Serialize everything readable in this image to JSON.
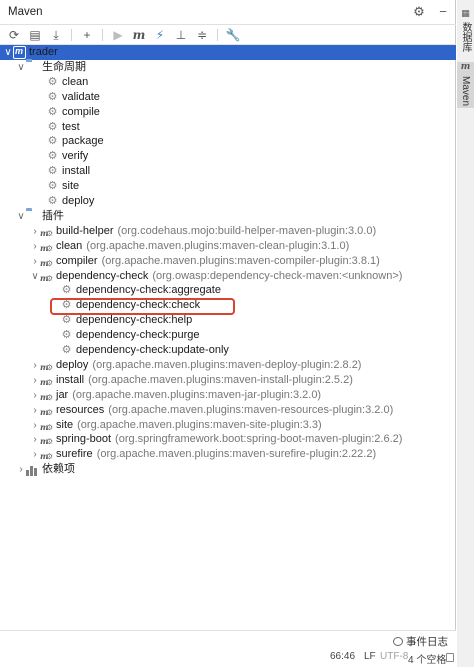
{
  "window": {
    "title": "Maven",
    "settings_icon": "gear-icon",
    "hide_icon": "minus-icon"
  },
  "toolbar": [
    {
      "name": "reload-button",
      "glyph": "⟳",
      "icon": "reload-icon"
    },
    {
      "name": "add-project-button",
      "glyph": "▤",
      "icon": "folder-plus-icon"
    },
    {
      "name": "download-button",
      "glyph": "⤓",
      "icon": "download-icon"
    },
    {
      "name": "add-button",
      "glyph": "+",
      "icon": "plus-icon"
    },
    {
      "name": "run-button",
      "glyph": "▶",
      "icon": "run-icon"
    },
    {
      "name": "execute-goal-button",
      "glyph": "m",
      "icon": "maven-icon"
    },
    {
      "name": "toggle-offline-button",
      "glyph": "⚡",
      "icon": "lightning-icon"
    },
    {
      "name": "skip-tests-button",
      "glyph": "⊥",
      "icon": "skip-tests-icon"
    },
    {
      "name": "show-dependencies-button",
      "glyph": "≑",
      "icon": "collapse-icon"
    },
    {
      "name": "settings-button",
      "glyph": "🔧",
      "icon": "wrench-icon"
    }
  ],
  "tree": {
    "project": "trader",
    "lifecycle": {
      "label": "生命周期",
      "items": [
        "clean",
        "validate",
        "compile",
        "test",
        "package",
        "verify",
        "install",
        "site",
        "deploy"
      ]
    },
    "plugins": {
      "label": "插件",
      "items": [
        {
          "name": "build-helper",
          "coord": "(org.codehaus.mojo:build-helper-maven-plugin:3.0.0)",
          "expanded": false
        },
        {
          "name": "clean",
          "coord": "(org.apache.maven.plugins:maven-clean-plugin:3.1.0)",
          "expanded": false
        },
        {
          "name": "compiler",
          "coord": "(org.apache.maven.plugins:maven-compiler-plugin:3.8.1)",
          "expanded": false
        },
        {
          "name": "dependency-check",
          "coord": "(org.owasp:dependency-check-maven:<unknown>)",
          "expanded": true,
          "goals": [
            "dependency-check:aggregate",
            "dependency-check:check",
            "dependency-check:help",
            "dependency-check:purge",
            "dependency-check:update-only"
          ]
        },
        {
          "name": "deploy",
          "coord": "(org.apache.maven.plugins:maven-deploy-plugin:2.8.2)",
          "expanded": false
        },
        {
          "name": "install",
          "coord": "(org.apache.maven.plugins:maven-install-plugin:2.5.2)",
          "expanded": false
        },
        {
          "name": "jar",
          "coord": "(org.apache.maven.plugins:maven-jar-plugin:3.2.0)",
          "expanded": false
        },
        {
          "name": "resources",
          "coord": "(org.apache.maven.plugins:maven-resources-plugin:3.2.0)",
          "expanded": false
        },
        {
          "name": "site",
          "coord": "(org.apache.maven.plugins:maven-site-plugin:3.3)",
          "expanded": false
        },
        {
          "name": "spring-boot",
          "coord": "(org.springframework.boot:spring-boot-maven-plugin:2.6.2)",
          "expanded": false
        },
        {
          "name": "surefire",
          "coord": "(org.apache.maven.plugins:maven-surefire-plugin:2.22.2)",
          "expanded": false
        }
      ]
    },
    "dependencies": {
      "label": "依赖项"
    }
  },
  "highlight": {
    "target": "dependency-check:check",
    "color": "#d9442f"
  },
  "status_bar": {
    "event_log": "事件日志",
    "position": "66:46",
    "line_separator": "LF",
    "encoding": "UTF-8",
    "indent": "4 个空格"
  },
  "side_tabs": [
    {
      "label": "数据库",
      "icon": "database-icon"
    },
    {
      "label": "Maven",
      "icon": "maven-icon"
    }
  ],
  "colors": {
    "selection": "#2f65ca",
    "folder": "#7aa7d6",
    "coord_text": "#777777"
  }
}
